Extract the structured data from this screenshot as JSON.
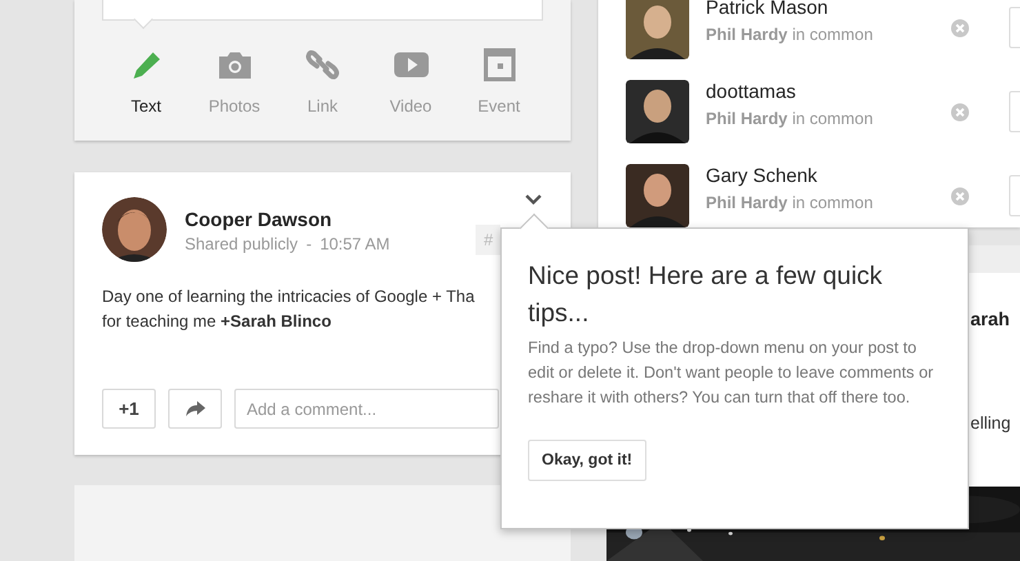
{
  "composer": {
    "tabs": [
      {
        "kind": "text",
        "label": "Text",
        "selected": true
      },
      {
        "kind": "photos",
        "label": "Photos",
        "selected": false
      },
      {
        "kind": "link",
        "label": "Link",
        "selected": false
      },
      {
        "kind": "video",
        "label": "Video",
        "selected": false
      },
      {
        "kind": "event",
        "label": "Event",
        "selected": false
      }
    ]
  },
  "post": {
    "author": "Cooper Dawson",
    "visibility": "Shared publicly",
    "separator": "-",
    "time": "10:57 AM",
    "hashtag": "#",
    "body": [
      "Day one of learning the intricacies of Google + Tha",
      "for teaching me **+Sarah Blinco**"
    ],
    "plus_one": "+1",
    "comment_placeholder": "Add a comment..."
  },
  "suggestions": [
    {
      "name": "Patrick Mason",
      "mutual": "**Phil Hardy** in common"
    },
    {
      "name": "doottamas",
      "mutual": "**Phil Hardy** in common"
    },
    {
      "name": "Gary Schenk",
      "mutual": "**Phil Hardy** in common"
    }
  ],
  "side_card": {
    "texts": [
      "arah",
      "elling"
    ],
    "image": {
      "kind": "picture"
    }
  },
  "tip": {
    "title": "Nice post! Here are a few quick tips...",
    "body": "Find a typo? Use the drop-down menu on your post to edit or delete it. Don't want people to leave comments or reshare it with others? You can turn that off there too.",
    "button": "Okay, got it!"
  }
}
